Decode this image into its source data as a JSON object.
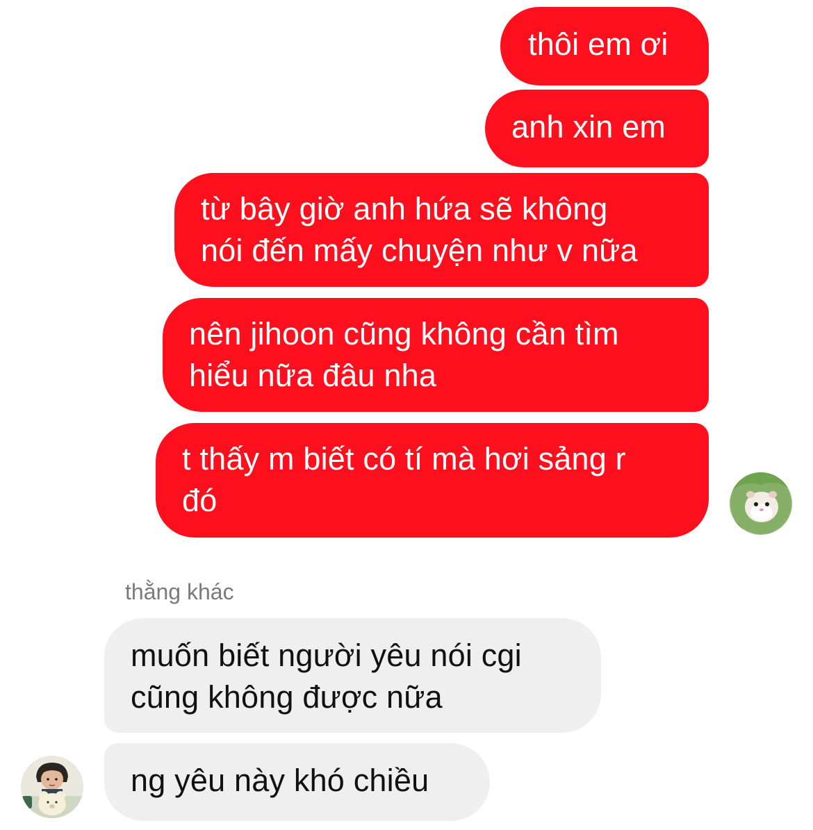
{
  "conversation": {
    "outgoing": [
      {
        "text": "thôi em ơi"
      },
      {
        "text": "anh xin em"
      },
      {
        "text": "từ bây giờ anh hứa sẽ không\nnói đến mấy chuyện như v nữa"
      },
      {
        "text": "nên jihoon cũng không cần tìm\nhiểu nữa đâu nha"
      },
      {
        "text": "t thấy m biết có tí mà hơi sảng r\nđó"
      }
    ],
    "sender_name": "thằng khác",
    "incoming": [
      {
        "text": "muốn biết người yêu nói cgi\ncũng không được nữa"
      },
      {
        "text": "ng yêu này khó chiều"
      }
    ]
  },
  "avatars": {
    "self": {
      "icon": "hamster-avatar-icon"
    },
    "other": {
      "icon": "child-with-teddy-avatar-icon"
    }
  },
  "colors": {
    "outgoing_bubble": "#fe0f1d",
    "incoming_bubble": "#efeff0",
    "outgoing_text": "#ffffff",
    "incoming_text": "#111111",
    "sender_name_text": "#7a7a7a"
  }
}
